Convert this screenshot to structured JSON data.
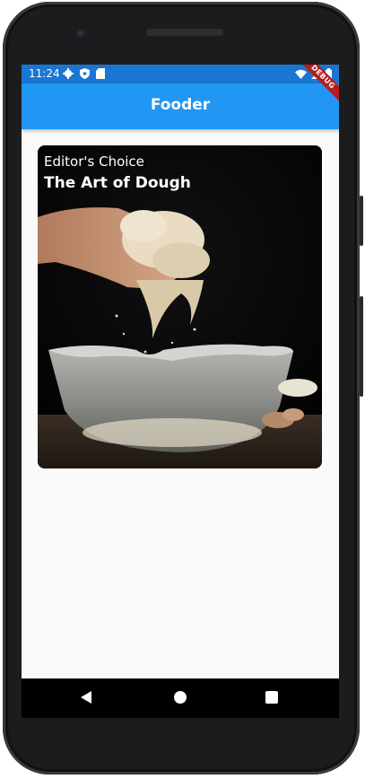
{
  "status_bar": {
    "time": "11:24",
    "left_icons": [
      "gear-icon",
      "shield-icon",
      "sd-card-icon"
    ],
    "right_icons": [
      "wifi-icon",
      "signal-icon",
      "battery-icon"
    ]
  },
  "app_bar": {
    "title": "Fooder"
  },
  "debug_banner": {
    "label": "DEBUG"
  },
  "card": {
    "eyebrow": "Editor's Choice",
    "title": "The Art of Dough",
    "image": "hands-kneading-dough-over-glass-bowl"
  },
  "nav_bar": {
    "buttons": [
      "back",
      "home",
      "recents"
    ]
  },
  "colors": {
    "status_bar": "#1976d2",
    "app_bar": "#2196f3",
    "background": "#fafafa",
    "debug": "#b71c1c"
  }
}
